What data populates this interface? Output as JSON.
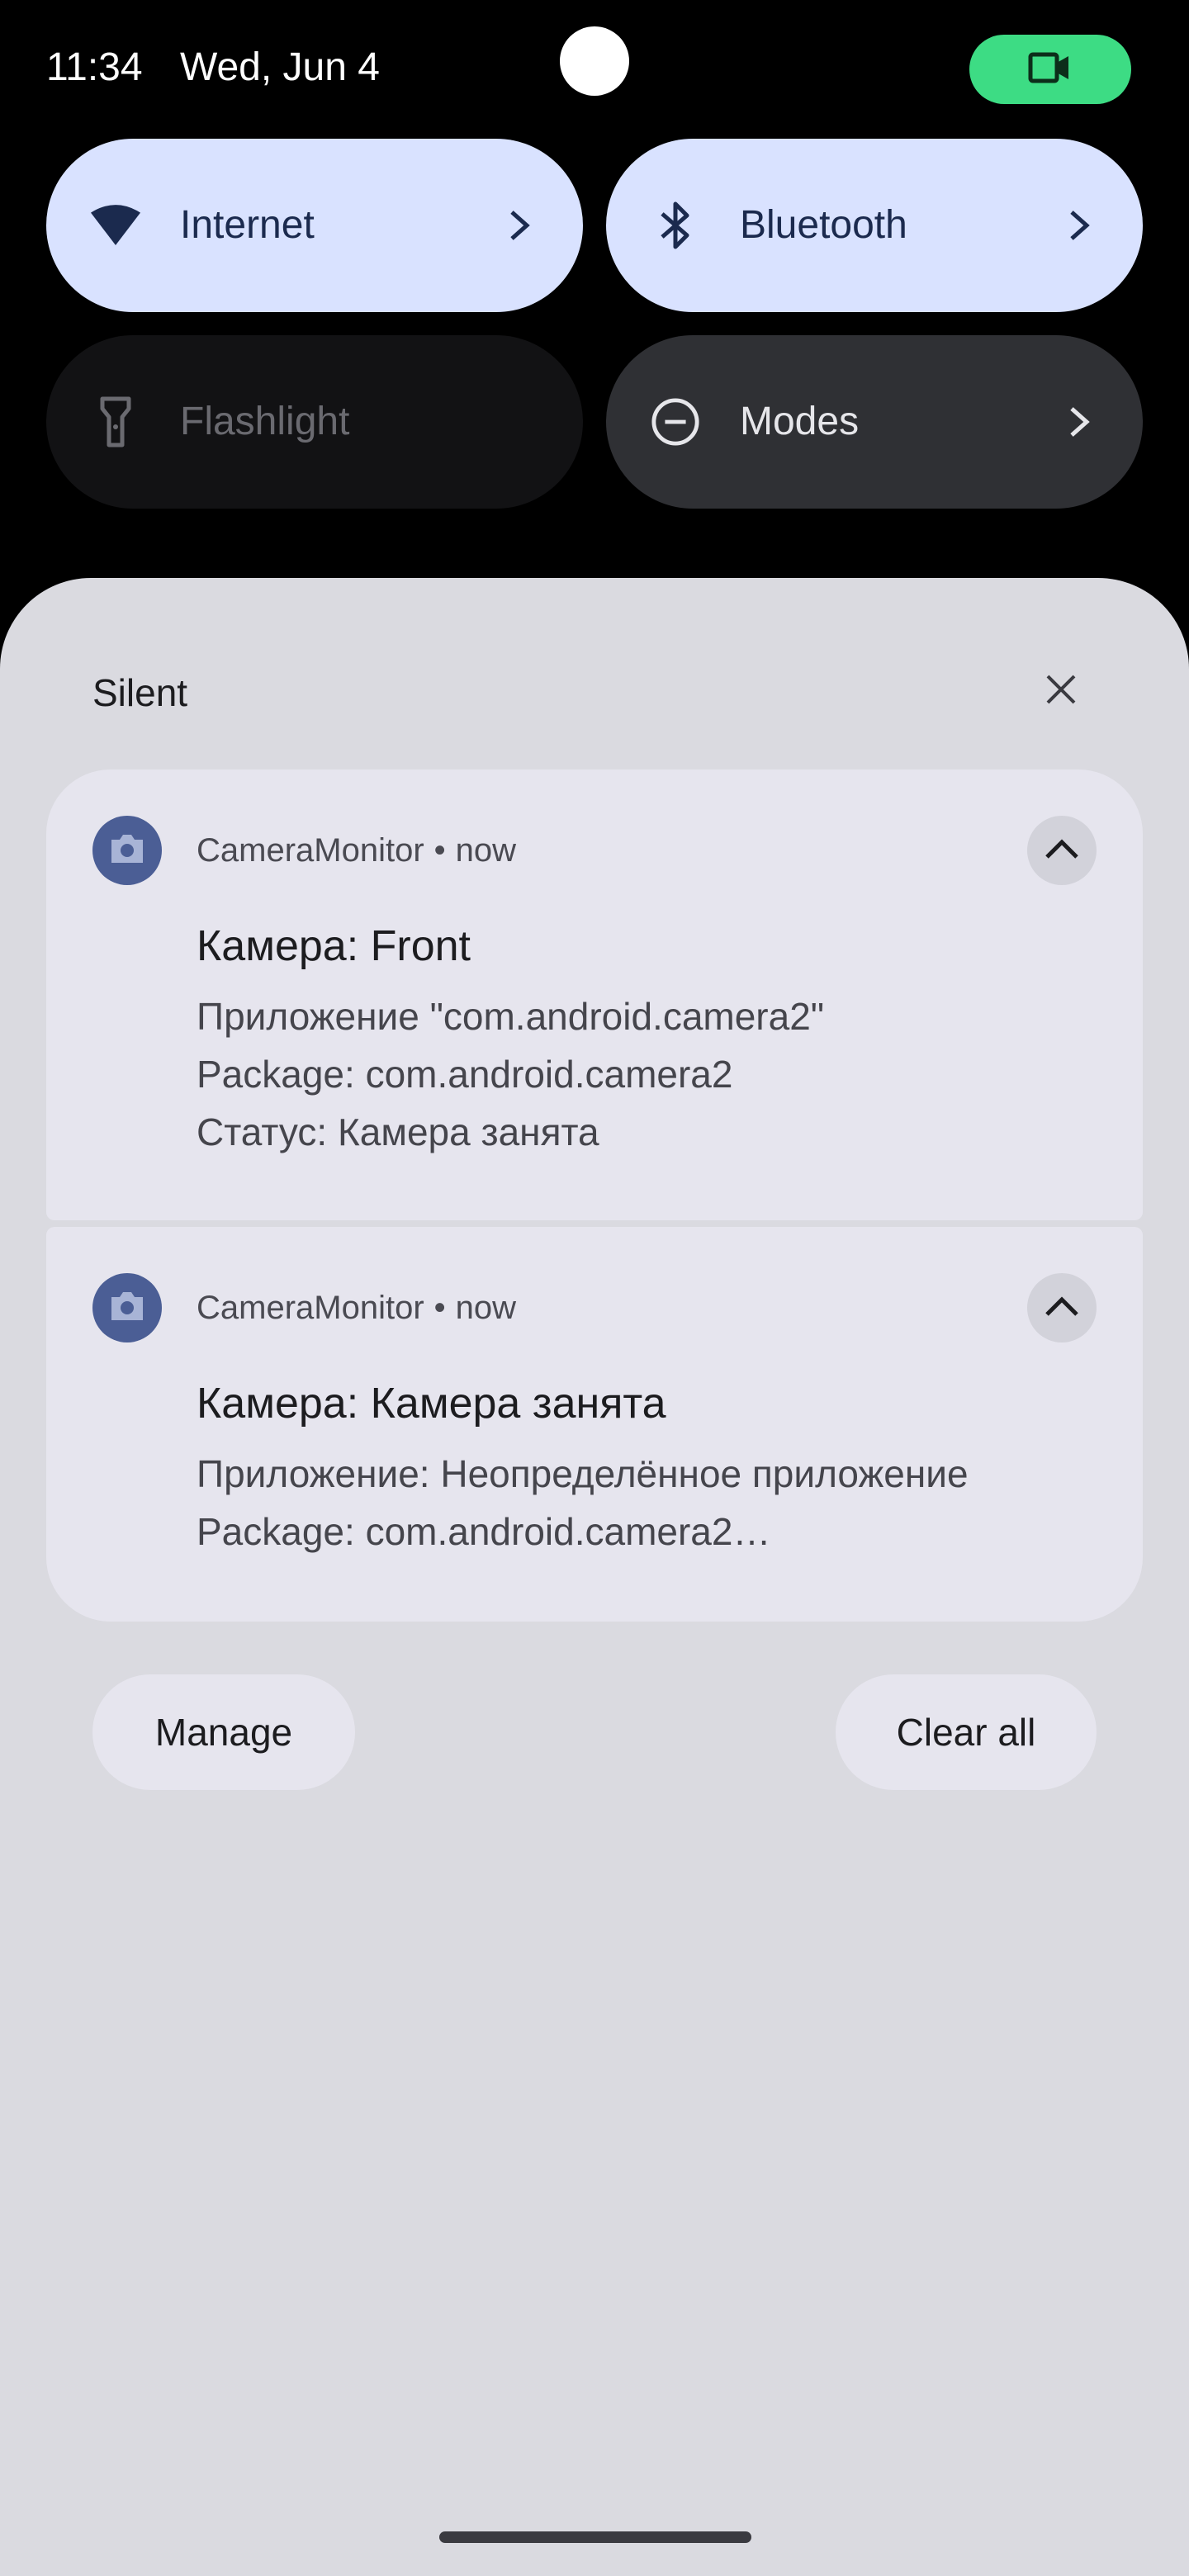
{
  "status_bar": {
    "time": "11:34",
    "date": "Wed, Jun 4",
    "privacy_chip_icon": "videocam-icon",
    "privacy_chip_color": "#3ddc84"
  },
  "quick_settings": {
    "tiles": [
      {
        "label": "Internet",
        "icon": "wifi-icon",
        "state": "active",
        "has_chevron": true
      },
      {
        "label": "Bluetooth",
        "icon": "bluetooth-icon",
        "state": "active",
        "has_chevron": true
      },
      {
        "label": "Flashlight",
        "icon": "flashlight-icon",
        "state": "disabled",
        "has_chevron": false
      },
      {
        "label": "Modes",
        "icon": "do-not-disturb-icon",
        "state": "inactive",
        "has_chevron": true
      }
    ]
  },
  "shade": {
    "section_title": "Silent",
    "dismiss_icon": "close-icon",
    "notifications": [
      {
        "app": "CameraMonitor",
        "time": "now",
        "title": "Камера: Front",
        "lines": [
          "Приложение \"com.android.camera2\"",
          "Package: com.android.camera2",
          "Статус: Камера занята"
        ],
        "expanded": true
      },
      {
        "app": "CameraMonitor",
        "time": "now",
        "title": "Камера: Камера занята",
        "lines": [
          "Приложение: Неопределённое приложение",
          "Package: com.android.camera2…"
        ],
        "expanded": true
      }
    ],
    "manage_label": "Manage",
    "clear_all_label": "Clear all"
  },
  "colors": {
    "active_tile": "#d9e2ff",
    "shade_bg": "#dadae0",
    "card_bg": "#e6e5ee",
    "app_icon_bg": "#4b5e95"
  }
}
